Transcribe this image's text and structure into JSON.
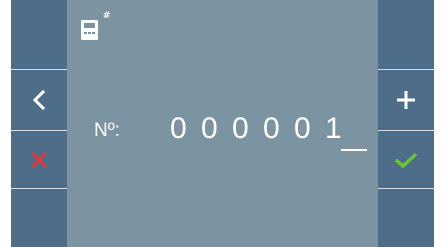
{
  "nav": {
    "back_icon": "chevron-left-icon",
    "cancel_icon": "x-icon",
    "increment_icon": "plus-icon",
    "confirm_icon": "check-icon"
  },
  "header": {
    "device_icon": "intercom-device-icon",
    "hash": "#"
  },
  "entry": {
    "label": "Nº:",
    "digits": [
      "0",
      "0",
      "0",
      "0",
      "0",
      "1"
    ]
  },
  "colors": {
    "screen_bg": "#7c93a2",
    "side_bar": "#4d6d88",
    "cancel_red": "#e0383f",
    "confirm_green": "#69c232",
    "text": "#ffffff"
  }
}
